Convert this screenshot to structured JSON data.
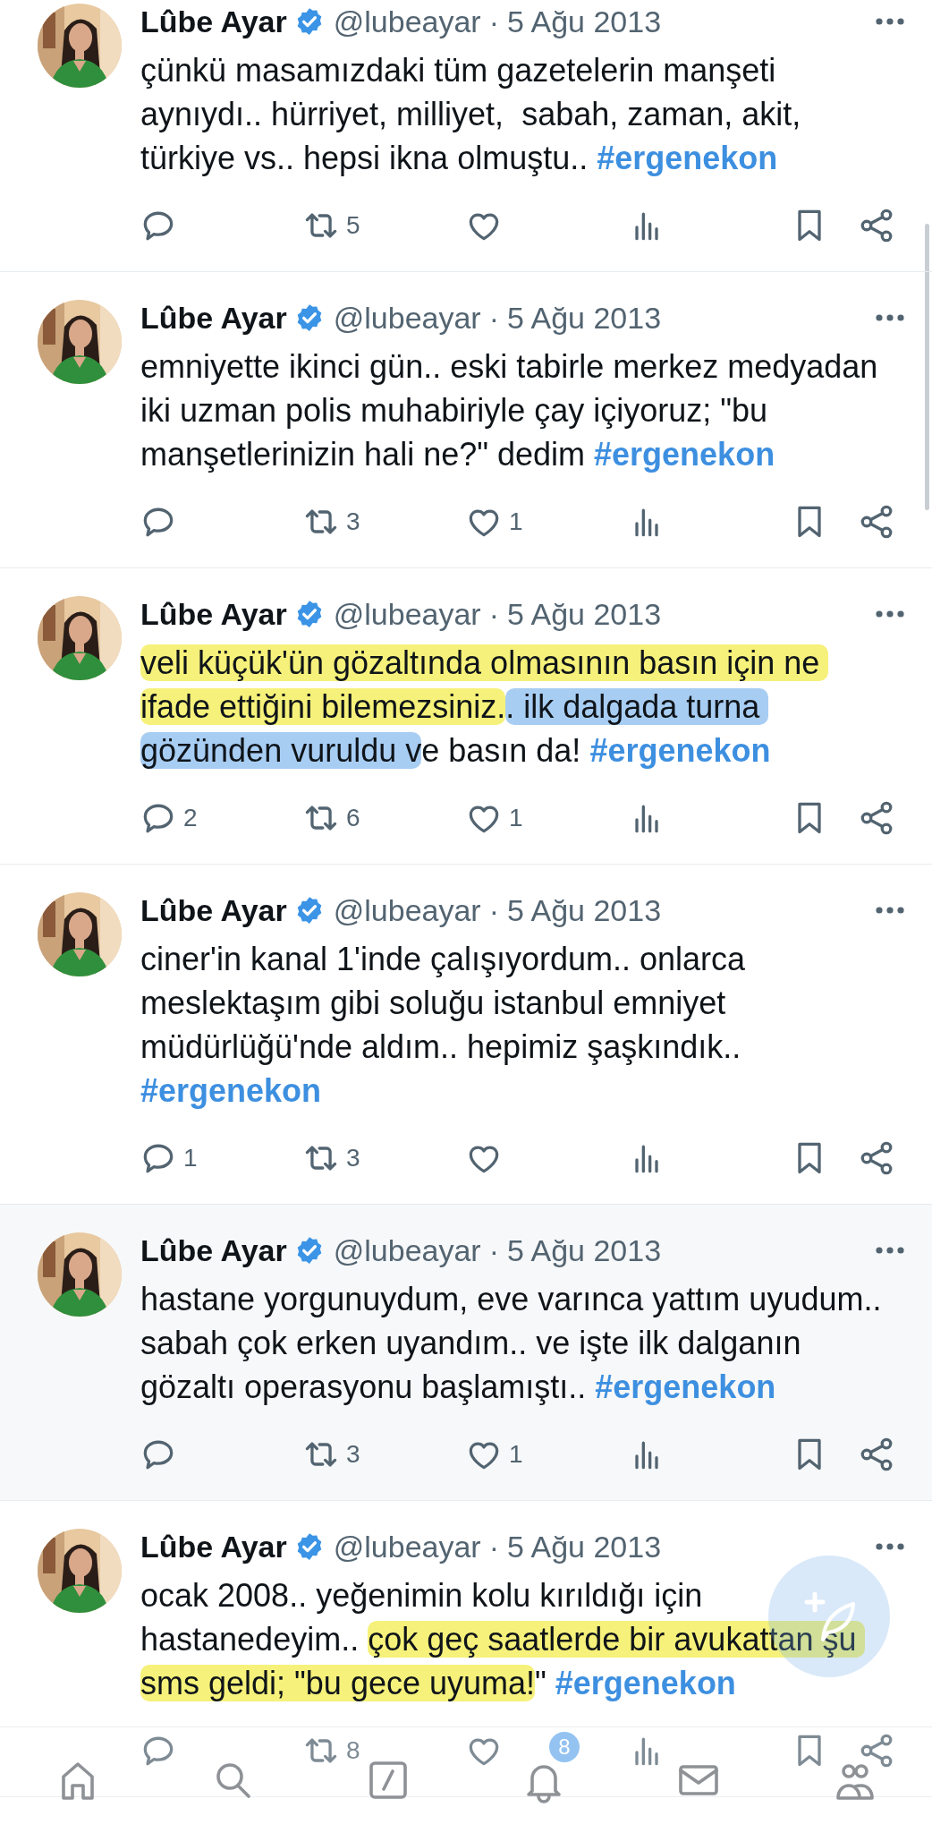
{
  "tweets": [
    {
      "author": {
        "name": "Lûbe Ayar",
        "verified": true
      },
      "handle": "@lubeayar",
      "dot": "·",
      "date": "5 Ağu 2013",
      "shaded": false,
      "segments": [
        {
          "kind": "plain",
          "text": "çünkü masamızdaki tüm gazetelerin manşeti aynıydı.. hürriyet, milliyet,  sabah, zaman, akit, türkiye vs.. hepsi ikna olmuştu.. "
        },
        {
          "kind": "hashtag",
          "text": "#ergenekon"
        }
      ],
      "actions": {
        "retweets": "5"
      }
    },
    {
      "author": {
        "name": "Lûbe Ayar",
        "verified": true
      },
      "handle": "@lubeayar",
      "dot": "·",
      "date": "5 Ağu 2013",
      "shaded": false,
      "segments": [
        {
          "kind": "plain",
          "text": "emniyette ikinci gün.. eski tabirle merkez medyadan iki uzman polis muhabiriyle çay içiyoruz; \"bu manşetlerinizin hali ne?\" dedim "
        },
        {
          "kind": "hashtag",
          "text": "#ergenekon"
        }
      ],
      "actions": {
        "retweets": "3",
        "likes": "1"
      }
    },
    {
      "author": {
        "name": "Lûbe Ayar",
        "verified": true
      },
      "handle": "@lubeayar",
      "dot": "·",
      "date": "5 Ağu 2013",
      "shaded": false,
      "segments": [
        {
          "kind": "plain",
          "text": "veli küçük'ün gözaltında olmasının basın için ne ifade ettiğini bilemezsiniz.",
          "color": "#f6f17a"
        },
        {
          "kind": "plain",
          "text": ". ilk dalgada turna gözünden vuruldu v",
          "color": "#a8cdf3"
        },
        {
          "kind": "plain",
          "text": "e basın da! "
        },
        {
          "kind": "hashtag",
          "text": "#ergenekon"
        }
      ],
      "actions": {
        "replies": "2",
        "retweets": "6",
        "likes": "1"
      }
    },
    {
      "author": {
        "name": "Lûbe Ayar",
        "verified": true
      },
      "handle": "@lubeayar",
      "dot": "·",
      "date": "5 Ağu 2013",
      "shaded": false,
      "segments": [
        {
          "kind": "plain",
          "text": "ciner'in kanal 1'inde çalışıyordum.. onlarca meslektaşım gibi soluğu istanbul emniyet müdürlüğü'nde aldım.. hepimiz şaşkındık.. "
        },
        {
          "kind": "hashtag",
          "text": "#ergenekon"
        }
      ],
      "actions": {
        "replies": "1",
        "retweets": "3"
      }
    },
    {
      "author": {
        "name": "Lûbe Ayar",
        "verified": true
      },
      "handle": "@lubeayar",
      "dot": "·",
      "date": "5 Ağu 2013",
      "shaded": true,
      "segments": [
        {
          "kind": "plain",
          "text": "hastane yorgunuydum, eve varınca yattım uyudum.. sabah çok erken uyandım.. ve işte ilk dalganın gözaltı operasyonu başlamıştı.. "
        },
        {
          "kind": "hashtag",
          "text": "#ergenekon"
        }
      ],
      "actions": {
        "retweets": "3",
        "likes": "1"
      }
    },
    {
      "author": {
        "name": "Lûbe Ayar",
        "verified": true
      },
      "handle": "@lubeayar",
      "dot": "·",
      "date": "5 Ağu 2013",
      "shaded": false,
      "segments": [
        {
          "kind": "plain",
          "text": "ocak 2008.. yeğenimin kolu kırıldığı için hastanedeyim.. "
        },
        {
          "kind": "plain",
          "text": "çok geç saatlerde bir avukattan şu sms geldi; \"bu gece uyuma!",
          "color": "#f6f17a"
        },
        {
          "kind": "plain",
          "text": "\" "
        },
        {
          "kind": "hashtag",
          "text": "#ergenekon"
        }
      ],
      "actions": {
        "retweets": "8"
      }
    }
  ],
  "nav": [
    {
      "kind": "home",
      "selected": false
    },
    {
      "kind": "search",
      "selected": false
    },
    {
      "kind": "compose",
      "selected": false
    },
    {
      "kind": "notifications",
      "selected": false,
      "badge": "8"
    },
    {
      "kind": "messages",
      "selected": false
    },
    {
      "kind": "communities",
      "selected": false
    }
  ]
}
